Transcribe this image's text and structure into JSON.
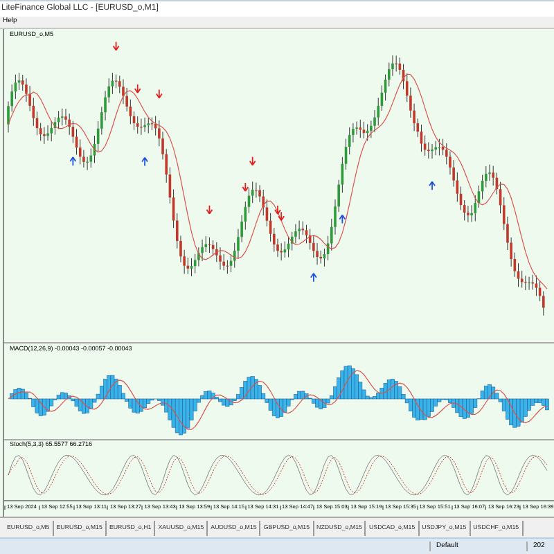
{
  "window": {
    "title": "LiteFinance Global LLC - [EURUSD_o,M1]"
  },
  "menu": [
    {
      "label": "Help"
    }
  ],
  "main_chart": {
    "label": "EURUSD_o,M5"
  },
  "macd": {
    "label": "MACD(12,26,9) -0.00043 -0.00057 -0.00043"
  },
  "stochastic": {
    "label": "Stoch(5,3,3) 65.5577 66.2716"
  },
  "time_axis": [
    "13 Sep 2024",
    "13 Sep 12:55",
    "13 Sep 13:11",
    "13 Sep 13:27",
    "13 Sep 13:43",
    "13 Sep 13:59",
    "13 Sep 14:15",
    "13 Sep 14:31",
    "13 Sep 14:47",
    "13 Sep 15:03",
    "13 Sep 15:19",
    "13 Sep 15:35",
    "13 Sep 15:51",
    "13 Sep 16:07",
    "13 Sep 16:23",
    "13 Sep 16:39"
  ],
  "tabs": [
    {
      "label": "EURUSD_o,M5",
      "selected": false
    },
    {
      "label": "EURUSD_o,M15",
      "selected": false
    },
    {
      "label": "EURUSD_o,H1",
      "selected": false
    },
    {
      "label": "XAUUSD_o,M15",
      "selected": false
    },
    {
      "label": "AUDUSD_o,M15",
      "selected": false
    },
    {
      "label": "GBPUSD_o,M15",
      "selected": false
    },
    {
      "label": "NZDUSD_o,M15",
      "selected": false
    },
    {
      "label": "USDCAD_o,M15",
      "selected": false
    },
    {
      "label": "USDJPY_o,M15",
      "selected": false
    },
    {
      "label": "USDCHF_o,M15",
      "selected": false
    }
  ],
  "status_bar": [
    "Default",
    "202"
  ]
}
